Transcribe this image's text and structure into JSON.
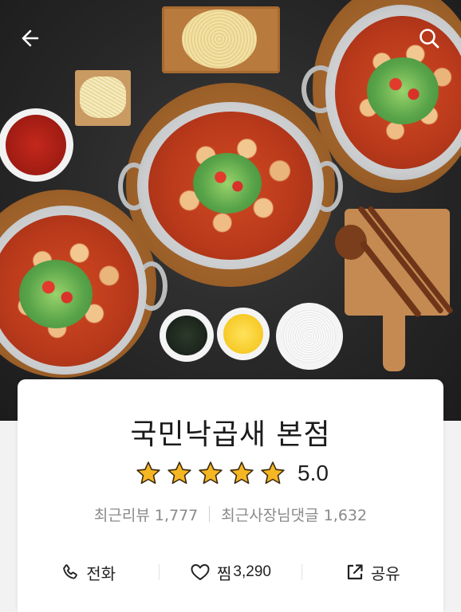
{
  "nav": {
    "back_icon": "arrow-left-icon",
    "search_icon": "search-icon"
  },
  "store": {
    "name": "국민낙곱새 본점",
    "rating": 5.0,
    "rating_text": "5.0",
    "stars_filled": 5,
    "stars_total": 5
  },
  "stats": {
    "recent_reviews_label": "최근리뷰",
    "recent_reviews_count": "1,777",
    "owner_replies_label": "최근사장님댓글",
    "owner_replies_count": "1,632"
  },
  "actions": {
    "call_label": "전화",
    "call_icon": "phone-icon",
    "like_label": "찜",
    "like_count": "3,290",
    "like_icon": "heart-icon",
    "share_label": "공유",
    "share_icon": "share-icon"
  },
  "colors": {
    "star": "#f5b623",
    "star_outline": "#3a2a10",
    "text_primary": "#1b1b1b",
    "text_secondary": "#8a8a8a"
  }
}
